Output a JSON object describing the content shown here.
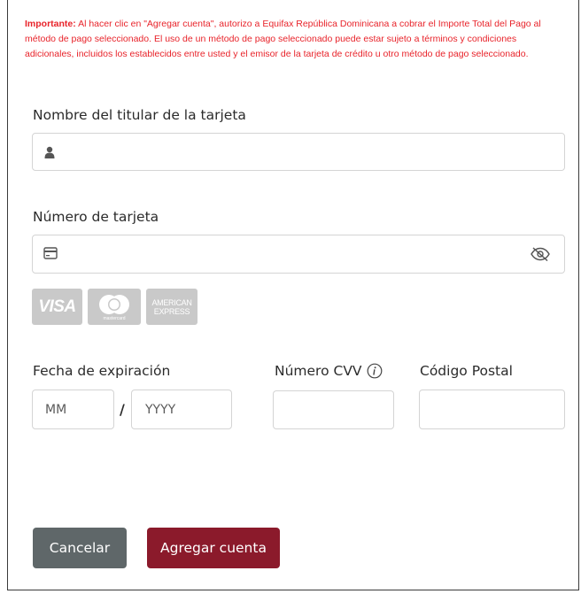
{
  "notice": {
    "prefix": "Importante:",
    "text": " Al hacer clic en \"Agregar cuenta\", autorizo a Equifax República Dominicana a cobrar el Importe Total del Pago al método de pago seleccionado. El uso de un método de pago seleccionado puede estar sujeto a términos y condiciones adicionales, incluidos los establecidos entre usted y el emisor de la tarjeta de crédito u otro método de pago seleccionado."
  },
  "cardholder": {
    "label": "Nombre del titular de la tarjeta",
    "value": "",
    "icon": "user-icon"
  },
  "card_number": {
    "label": "Número de tarjeta",
    "value": "",
    "icon": "credit-card-icon",
    "toggle_icon": "eye-slash-icon"
  },
  "card_logos": [
    {
      "name": "VISA",
      "icon": "visa-logo"
    },
    {
      "name": "mastercard",
      "icon": "mastercard-logo"
    },
    {
      "name": "AMERICAN EXPRESS",
      "icon": "amex-logo"
    }
  ],
  "expiration": {
    "label": "Fecha de expiración",
    "month_placeholder": "MM",
    "separator": "/",
    "year_placeholder": "YYYY"
  },
  "cvv": {
    "label": "Número CVV",
    "info_icon": "info-icon",
    "value": ""
  },
  "postal": {
    "label": "Código Postal",
    "value": ""
  },
  "buttons": {
    "cancel": "Cancelar",
    "add": "Agregar cuenta"
  },
  "colors": {
    "notice_red": "#e8232a",
    "cancel_bg": "#5f6769",
    "add_bg": "#8b1a2b"
  }
}
